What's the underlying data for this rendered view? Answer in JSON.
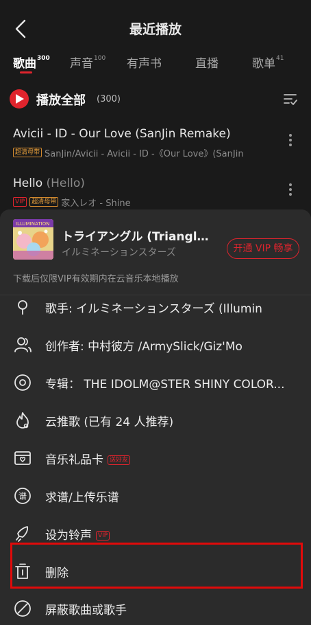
{
  "header": {
    "title": "最近播放"
  },
  "tabs": [
    {
      "label": "歌曲",
      "count": "300"
    },
    {
      "label": "声音",
      "count": "100"
    },
    {
      "label": "有声书",
      "count": ""
    },
    {
      "label": "直播",
      "count": ""
    },
    {
      "label": "歌单",
      "count": "41"
    }
  ],
  "play_all": {
    "label": "播放全部",
    "count": "(300)"
  },
  "songs": [
    {
      "title": "Avicii - ID - Our Love (SanJin Remake)",
      "subtitle": "",
      "tags": [
        "超清母带"
      ],
      "artist": "SanJin/Avicii - Avicii - ID -《Our Love》(SanJin"
    },
    {
      "title": "Hello",
      "subtitle": "(Hello)",
      "tags": [
        "VIP",
        "超清母带"
      ],
      "artist": "家入レオ - Shine"
    }
  ],
  "sheet": {
    "song_title": "トライアングル (Triangle...",
    "song_artist": "イルミネーションスターズ",
    "vip_button": "开通 VIP 畅享",
    "notice": "下载后仅限VIP有效期内在云音乐本地播放",
    "menu": [
      {
        "label": "歌手: イルミネーションスターズ (Illumin",
        "icon": "singer-icon"
      },
      {
        "label": "创作者: 中村彼方 /ArmySlick/Giz'Mo",
        "icon": "creators-icon"
      },
      {
        "label": "专辑： THE IDOLM@STER SHINY COLOR...",
        "icon": "album-icon"
      },
      {
        "label": "云推歌 (已有 24 人推荐)",
        "icon": "flame-icon"
      },
      {
        "label": "音乐礼品卡",
        "icon": "gift-card-icon",
        "badge": "送好友"
      },
      {
        "label": "求谱/上传乐谱",
        "icon": "score-icon"
      },
      {
        "label": "设为铃声",
        "icon": "ringtone-icon",
        "badge": "VIP"
      },
      {
        "label": "删除",
        "icon": "trash-icon"
      },
      {
        "label": "屏蔽歌曲或歌手",
        "icon": "block-icon"
      }
    ]
  },
  "colors": {
    "accent": "#e0242d",
    "background": "#1a1a1a",
    "sheet": "#2b2b2b",
    "highlight": "#e10a0a"
  }
}
